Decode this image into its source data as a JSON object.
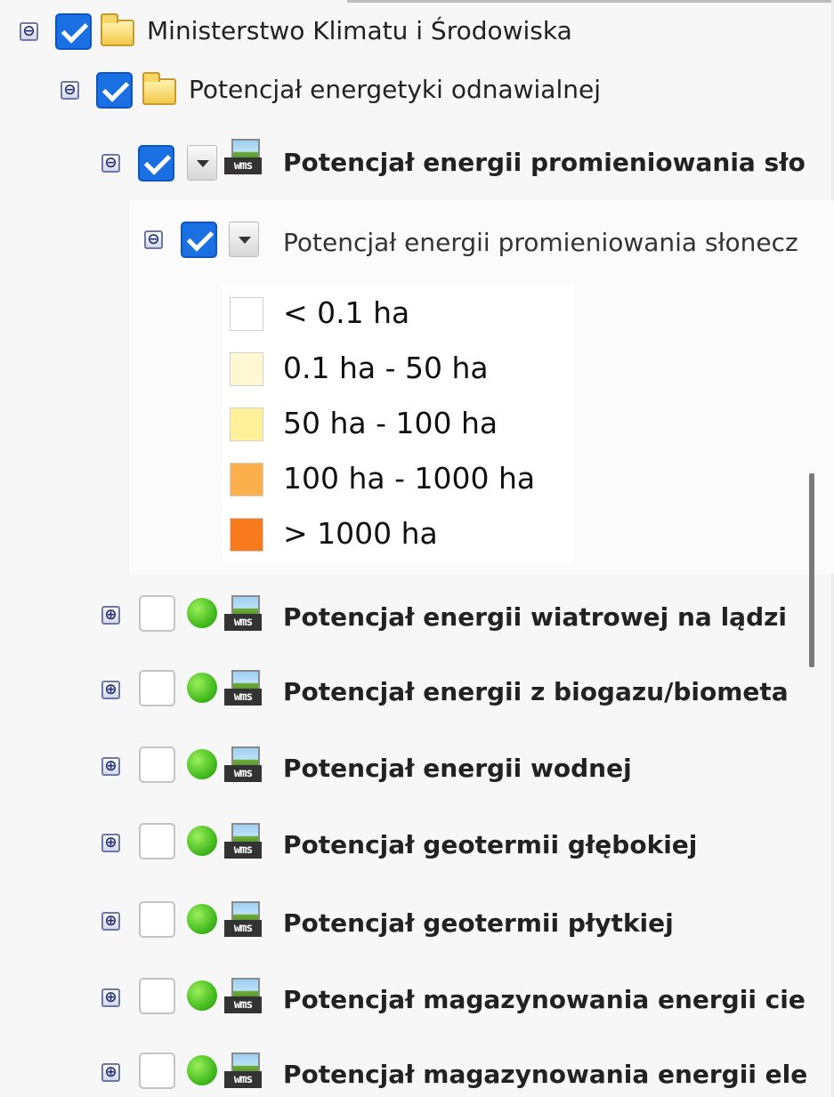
{
  "tree": {
    "root": {
      "label": "Ministerstwo Klimatu i Środowiska",
      "toggle": "⊖"
    },
    "group": {
      "label": "Potencjał energetyki odnawialnej",
      "toggle": "⊖"
    },
    "layer_solar": {
      "label": "Potencjał energii promieniowania sło",
      "toggle": "⊖",
      "service": "wms"
    },
    "sublayer_solar": {
      "label": "Potencjał energii promieniowania słonecz",
      "toggle": "⊖"
    },
    "legend": [
      {
        "label": "< 0.1 ha",
        "color": "#ffffff"
      },
      {
        "label": "0.1 ha - 50 ha",
        "color": "#fff8d2"
      },
      {
        "label": "50 ha - 100 ha",
        "color": "#fff09a"
      },
      {
        "label": "100 ha - 1000 ha",
        "color": "#fbb04c"
      },
      {
        "label": "> 1000 ha",
        "color": "#f97a1d"
      }
    ],
    "layers": [
      {
        "label": "Potencjał energii wiatrowej na lądzi",
        "toggle": "⊕",
        "service": "wms"
      },
      {
        "label": "Potencjał energii z biogazu/biometa",
        "toggle": "⊕",
        "service": "wms"
      },
      {
        "label": "Potencjał energii wodnej",
        "toggle": "⊕",
        "service": "wms"
      },
      {
        "label": "Potencjał geotermii głębokiej",
        "toggle": "⊕",
        "service": "wms"
      },
      {
        "label": "Potencjał geotermii płytkiej",
        "toggle": "⊕",
        "service": "wms"
      },
      {
        "label": "Potencjał magazynowania energii cie",
        "toggle": "⊕",
        "service": "wms"
      },
      {
        "label": "Potencjał magazynowania energii ele",
        "toggle": "⊕",
        "service": "wms"
      }
    ]
  }
}
